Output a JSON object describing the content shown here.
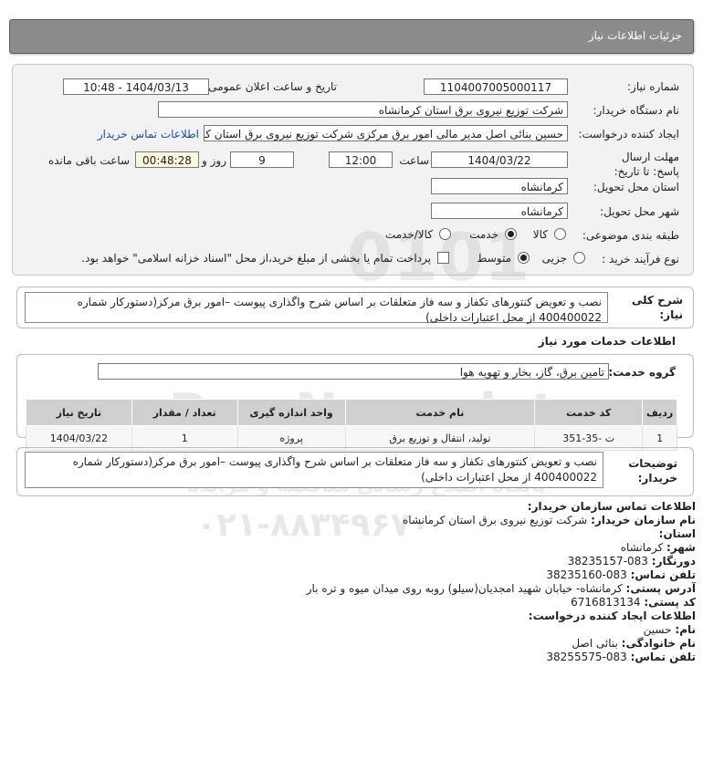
{
  "header": {
    "title": "جزئیات اطلاعات نیاز"
  },
  "form": {
    "need_number_label": "شماره نیاز:",
    "need_number": "1104007005000117",
    "announce_label": "تاریخ و ساعت اعلان عمومی:",
    "announce_value": "1404/03/13 - 10:48",
    "buyer_org_label": "نام دستگاه خریدار:",
    "buyer_org": "شرکت توزیع نیروی برق استان کرمانشاه",
    "creator_label": "ایجاد کننده درخواست:",
    "creator": "حسین بنائی اصل مدیر مالی امور برق مرکزی شرکت توزیع نیروی برق استان کرمانشاه",
    "contact_link": "اطلاعات تماس خریدار",
    "deadline_label": "مهلت ارسال پاسخ: تا تاریخ:",
    "deadline_date": "1404/03/22",
    "time_label": "ساعت",
    "deadline_time": "12:00",
    "days_value": "9",
    "days_label": "روز و",
    "remaining_time": "00:48:28",
    "remaining_label": "ساعت باقی مانده",
    "province_label": "استان محل تحویل:",
    "province": "کرمانشاه",
    "city_label": "شهر محل تحویل:",
    "city": "کرمانشاه",
    "category_label": "طبقه بندی موضوعی:",
    "category_options": [
      "کالا",
      "خدمت",
      "کالا/خدمت"
    ],
    "category_selected": "خدمت",
    "process_label": "نوع فرآیند خرید :",
    "process_options": [
      "جزیی",
      "متوسط"
    ],
    "process_selected": "متوسط",
    "payment_note": "پرداخت تمام یا بخشی از مبلغ خرید،از محل \"اسناد خزانه اسلامی\" خواهد بود."
  },
  "summary": {
    "label": "شرح کلی نیاز:",
    "text": "نصب و تعویض کنتورهای تکفاز و سه فاز متعلقات بر اساس شرح واگذاری پیوست –امور برق مرکز(دستورکار شماره 400400022 از محل اعتبارات داخلی)"
  },
  "services": {
    "section_title": "اطلاعات خدمات مورد نیاز",
    "group_label": "گروه خدمت:",
    "group_value": "تامین برق، گاز، بخار و تهویه هوا",
    "columns": [
      "ردیف",
      "کد خدمت",
      "نام خدمت",
      "واحد اندازه گیری",
      "تعداد / مقدار",
      "تاریخ نیاز"
    ],
    "rows": [
      {
        "row": "1",
        "code": "ت -35-351",
        "name": "تولید، انتقال و توزیع برق",
        "unit": "پروژه",
        "qty": "1",
        "date": "1404/03/22"
      }
    ]
  },
  "buyer_notes": {
    "label": "توضیحات خریدار:",
    "text": "نصب و تعویض کنتورهای تکفاز و سه فاز متعلقات بر اساس شرح واگذاری پیوست –امور برق مرکز(دستورکار شماره 400400022 از محل اعتبارات داخلی)"
  },
  "contact": {
    "title": "اطلاعات تماس سازمان خریدار:",
    "org_label": "نام سازمان خریدار:",
    "org": "شرکت توزیع نیروی برق استان کرمانشاه",
    "province_label": "استان:",
    "province": "کرمانشاه",
    "city_label": "شهر:",
    "city": "کرمانشاه",
    "fax_label": "دورنگار:",
    "fax": "083-38235157",
    "phone_label": "تلفن تماس:",
    "phone": "083-38235160",
    "address_label": "آدرس پستی:",
    "address": "کرمانشاه- خیابان شهید امجدیان(سیلو) روبه روی میدان میوه و تره بار",
    "postal_label": "کد پستی:",
    "postal": "6716813134",
    "creator_title": "اطلاعات ایجاد کننده درخواست:",
    "name_label": "نام:",
    "name": "حسین",
    "family_label": "نام خانوادگی:",
    "family": "بنائی اصل",
    "creator_phone_label": "تلفن تماس:",
    "creator_phone": "083-38255575"
  },
  "watermark": {
    "brand": "ParsNamadata",
    "tagline": "پایگاه اطلاع رسانی مناقصه و مزایده",
    "phone": "۰۲۱-۸۸۳۴۹۶۷۰"
  }
}
